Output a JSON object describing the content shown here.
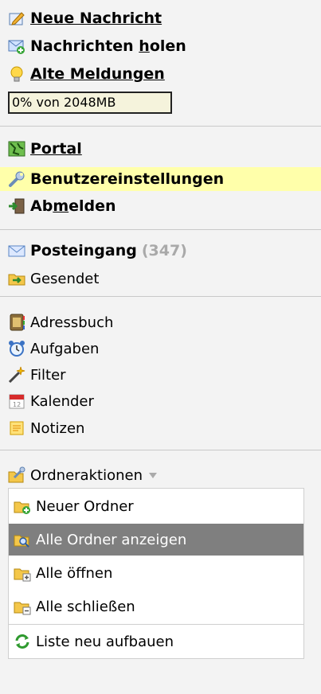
{
  "top_actions": {
    "new_message": "Neue Nachricht",
    "fetch_messages_pre": "Nachrichten ",
    "fetch_messages_u": "h",
    "fetch_messages_post": "olen",
    "old_alerts": "Alte Meldungen"
  },
  "quota": {
    "text": "0% von 2048MB",
    "percent": 0
  },
  "nav": {
    "portal": "Portal",
    "settings": "Benutzereinstellungen",
    "logout_pre": "Ab",
    "logout_u": "m",
    "logout_post": "elden"
  },
  "mail": {
    "inbox": "Posteingang",
    "inbox_count": "(347)",
    "sent": "Gesendet"
  },
  "apps": [
    "Adressbuch",
    "Aufgaben",
    "Filter",
    "Kalender",
    "Notizen"
  ],
  "folder_actions": {
    "label": "Ordneraktionen",
    "menu": {
      "new_folder": "Neuer Ordner",
      "show_all": "Alle Ordner anzeigen",
      "open_all": "Alle öffnen",
      "close_all": "Alle schließen",
      "rebuild": "Liste neu aufbauen"
    }
  },
  "colors": {
    "highlight": "#ffffaa",
    "selected": "#7f7f7f",
    "count": "#a9a9a9"
  }
}
